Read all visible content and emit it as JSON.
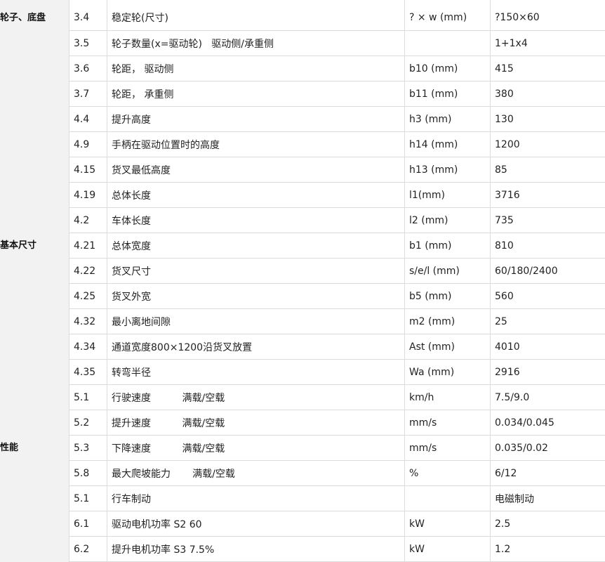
{
  "categories": [
    {
      "label": "轮子、底盘"
    },
    {
      "label": "基本尺寸"
    },
    {
      "label": "性能"
    }
  ],
  "rows": [
    {
      "no": "3.4",
      "item": "稳定轮(尺寸)",
      "unit": "? × w (mm)",
      "value": "?150×60"
    },
    {
      "no": "3.5",
      "item": "轮子数量(x=驱动轮)   驱动侧/承重侧",
      "unit": "",
      "value": "1+1x4"
    },
    {
      "no": "3.6",
      "item": "轮距， 驱动侧",
      "unit": "b10 (mm)",
      "value": "415"
    },
    {
      "no": "3.7",
      "item": "轮距， 承重侧",
      "unit": "b11 (mm)",
      "value": "380"
    },
    {
      "no": "4.4",
      "item": "提升高度",
      "unit": "h3 (mm)",
      "value": "130"
    },
    {
      "no": "4.9",
      "item": "手柄在驱动位置时的高度",
      "unit": "h14 (mm)",
      "value": "1200"
    },
    {
      "no": "4.15",
      "item": "货叉最低高度",
      "unit": "h13 (mm)",
      "value": "85"
    },
    {
      "no": "4.19",
      "item": "总体长度",
      "unit": "l1(mm)",
      "value": "3716"
    },
    {
      "no": "4.2",
      "item": "车体长度",
      "unit": "l2 (mm)",
      "value": "735"
    },
    {
      "no": "4.21",
      "item": "总体宽度",
      "unit": "b1 (mm)",
      "value": "810"
    },
    {
      "no": "4.22",
      "item": "货叉尺寸",
      "unit": "s/e/l (mm)",
      "value": "60/180/2400"
    },
    {
      "no": "4.25",
      "item": "货叉外宽",
      "unit": "b5 (mm)",
      "value": "560"
    },
    {
      "no": "4.32",
      "item": "最小离地间隙",
      "unit": "m2 (mm)",
      "value": "25"
    },
    {
      "no": "4.34",
      "item": "通道宽度800×1200沿货叉放置",
      "unit": "Ast (mm)",
      "value": "4010"
    },
    {
      "no": "4.35",
      "item": "转弯半径",
      "unit": "Wa (mm)",
      "value": "2916"
    },
    {
      "no": "5.1",
      "item": "行驶速度          满载/空载",
      "unit": "km/h",
      "value": "7.5/9.0"
    },
    {
      "no": "5.2",
      "item": "提升速度          满载/空载",
      "unit": "mm/s",
      "value": "0.034/0.045"
    },
    {
      "no": "5.3",
      "item": "下降速度          满载/空载",
      "unit": "mm/s",
      "value": "0.035/0.02"
    },
    {
      "no": "5.8",
      "item": "最大爬坡能力       满载/空载",
      "unit": "%",
      "value": "6/12"
    },
    {
      "no": "5.1",
      "item": "行车制动",
      "unit": "",
      "value": "电磁制动"
    },
    {
      "no": "6.1",
      "item": "驱动电机功率 S2 60",
      "unit": "kW",
      "value": "2.5"
    },
    {
      "no": "6.2",
      "item": "提升电机功率 S3 7.5%",
      "unit": "kW",
      "value": "1.2"
    }
  ]
}
